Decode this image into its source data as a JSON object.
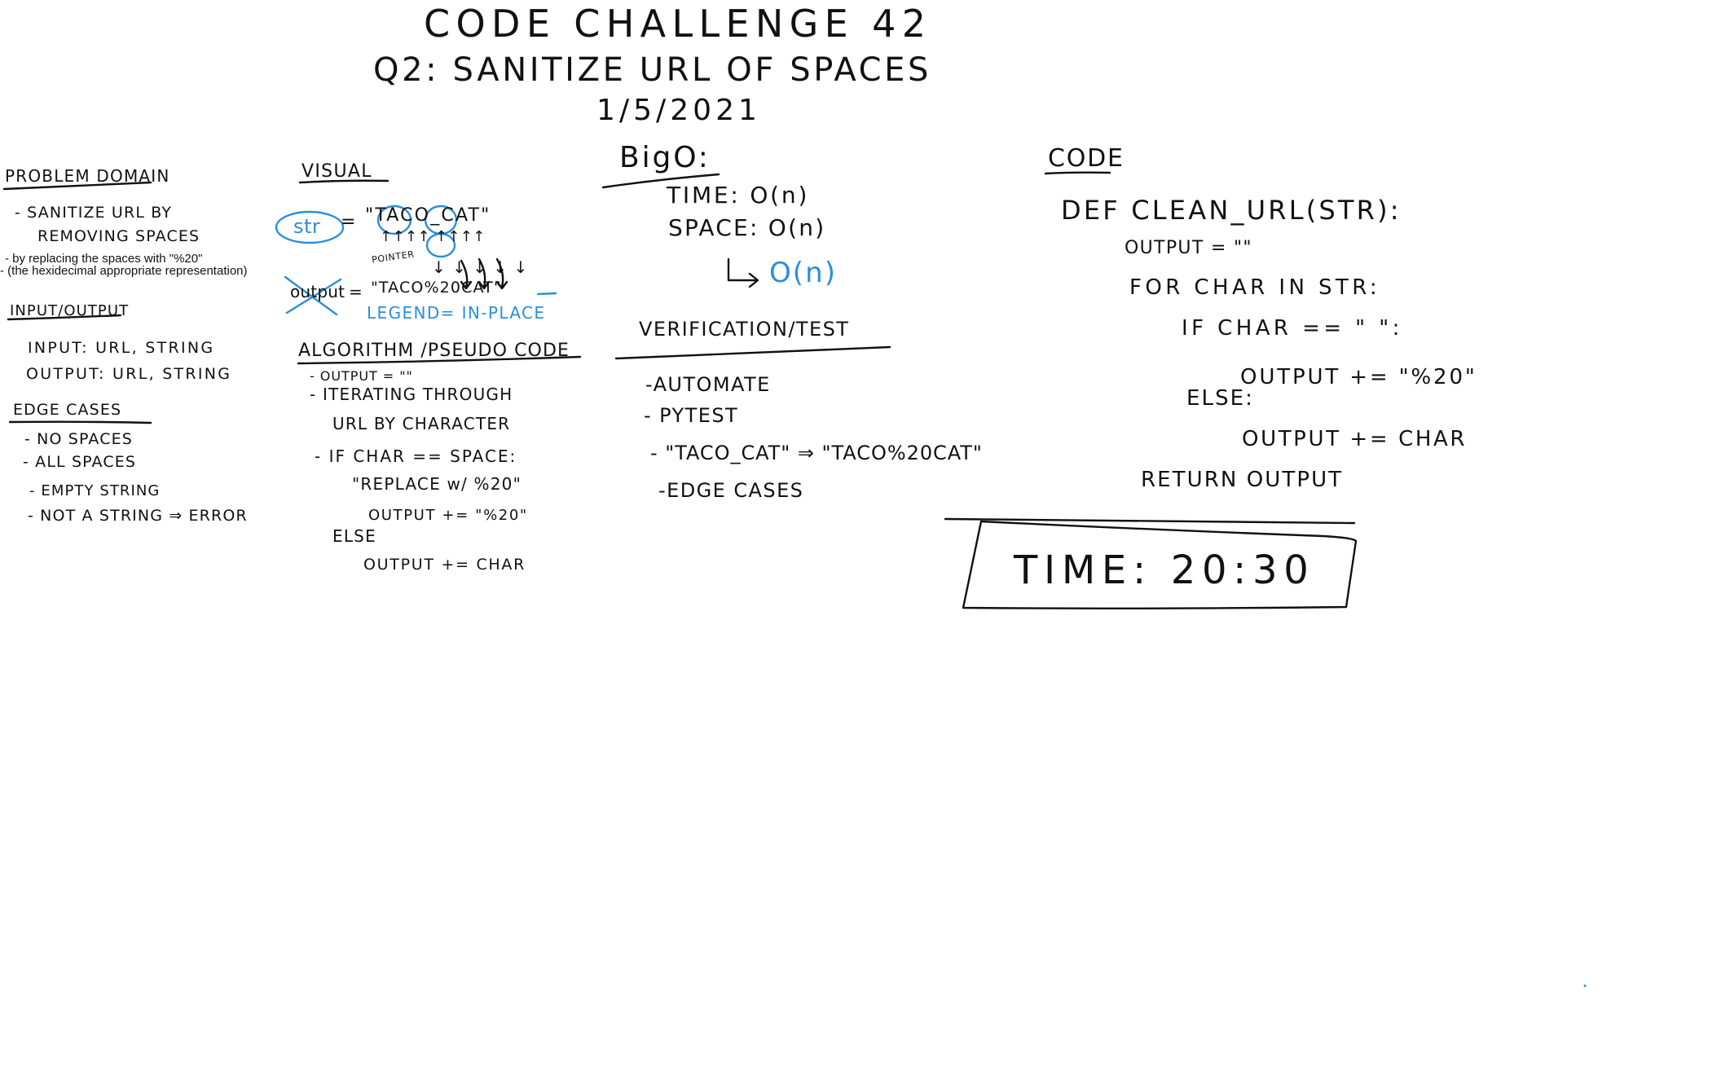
{
  "header": {
    "title": "CODE CHALLENGE 42",
    "subtitle": "Q2: SANITIZE URL OF SPACES",
    "date": "1/5/2021"
  },
  "problem_domain": {
    "heading": "PROBLEM DOMAIN",
    "line_1": "- SANITIZE URL BY",
    "line_2": "REMOVING SPACES",
    "note_1": "- by replacing the spaces with \"%20\"",
    "note_2": "- (the hexidecimal appropriate representation)"
  },
  "input_output": {
    "heading": "INPUT/OUTPUT",
    "input": "INPUT: URL, STRING",
    "output": "OUTPUT: URL, STRING"
  },
  "edge_cases": {
    "heading": "EDGE CASES",
    "items": [
      "- NO SPACES",
      "- ALL SPACES",
      "- EMPTY STRING",
      "- NOT A STRING ⇒ ERROR"
    ]
  },
  "visual": {
    "heading": "VISUAL",
    "str_label": "str",
    "equals_1": "=",
    "input_string": "\"TACO_CAT\"",
    "arrows_top": "↑↑↑↑ ↑↑↑↑",
    "pointer_label": "POINTER",
    "arrows_down": "↓ ↓ ↓ ↓ ↓",
    "output_label": "output",
    "equals_2": "=",
    "output_string": "\"TACO%20CAT\"",
    "legend": "LEGEND= IN-PLACE"
  },
  "algorithm": {
    "heading": "ALGORITHM /PSEUDO CODE",
    "lines": [
      "- OUTPUT = \"\"",
      "- ITERATING THROUGH",
      "URL BY CHARACTER",
      "- IF CHAR == SPACE:",
      "\"REPLACE w/ %20\"",
      "OUTPUT += \"%20\"",
      "ELSE",
      "OUTPUT += CHAR"
    ]
  },
  "big_o": {
    "heading": "BigO:",
    "time": "TIME: O(n)",
    "space": "SPACE: O(n)",
    "result": "O(n)"
  },
  "verification": {
    "heading": "VERIFICATION/TEST",
    "items": [
      "-AUTOMATE",
      "- PYTEST",
      "- \"TACO_CAT\" ⇒ \"TACO%20CAT\"",
      "-EDGE CASES"
    ]
  },
  "code": {
    "heading": "CODE",
    "lines": [
      "DEF CLEAN_URL(STR):",
      "OUTPUT = \"\"",
      "FOR CHAR IN STR:",
      "IF CHAR == \" \":",
      "OUTPUT += \"%20\"",
      "ELSE:",
      "OUTPUT += CHAR",
      "RETURN OUTPUT"
    ]
  },
  "timer": {
    "text": "TIME: 20:30"
  },
  "colors": {
    "ink": "#111111",
    "blue_ink": "#2a8fdc",
    "background": "#ffffff"
  }
}
